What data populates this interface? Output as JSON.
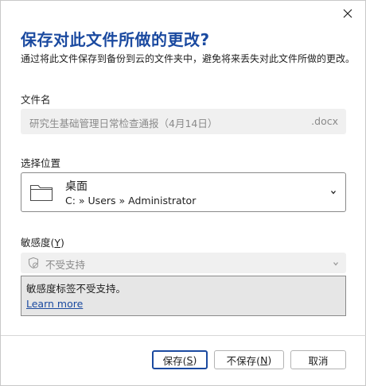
{
  "dialog": {
    "title": "保存对此文件所做的更改?",
    "subtitle": "通过将此文件保存到备份到云的文件夹中，避免将来丢失对此文件所做的更改。"
  },
  "filename": {
    "label": "文件名",
    "value": "研究生基础管理日常检查通报（4月14日）",
    "extension": ".docx"
  },
  "location": {
    "label": "选择位置",
    "name": "桌面",
    "path": "C: » Users » Administrator",
    "icon": "folder-icon"
  },
  "sensitivity": {
    "label_prefix": "敏感度(",
    "label_key": "Y",
    "label_suffix": ")",
    "selected": "不受支持",
    "icon": "sensitivity-icon",
    "info_text": "敏感度标签不受支持。",
    "learn_more": "Learn more"
  },
  "buttons": {
    "save_prefix": "保存(",
    "save_key": "S",
    "save_suffix": ")",
    "dontsave_prefix": "不保存(",
    "dontsave_key": "N",
    "dontsave_suffix": ")",
    "cancel": "取消"
  },
  "colors": {
    "accent": "#1b4aa0",
    "disabled_bg": "#f0f0f0",
    "info_bg": "#e6e6e6"
  }
}
